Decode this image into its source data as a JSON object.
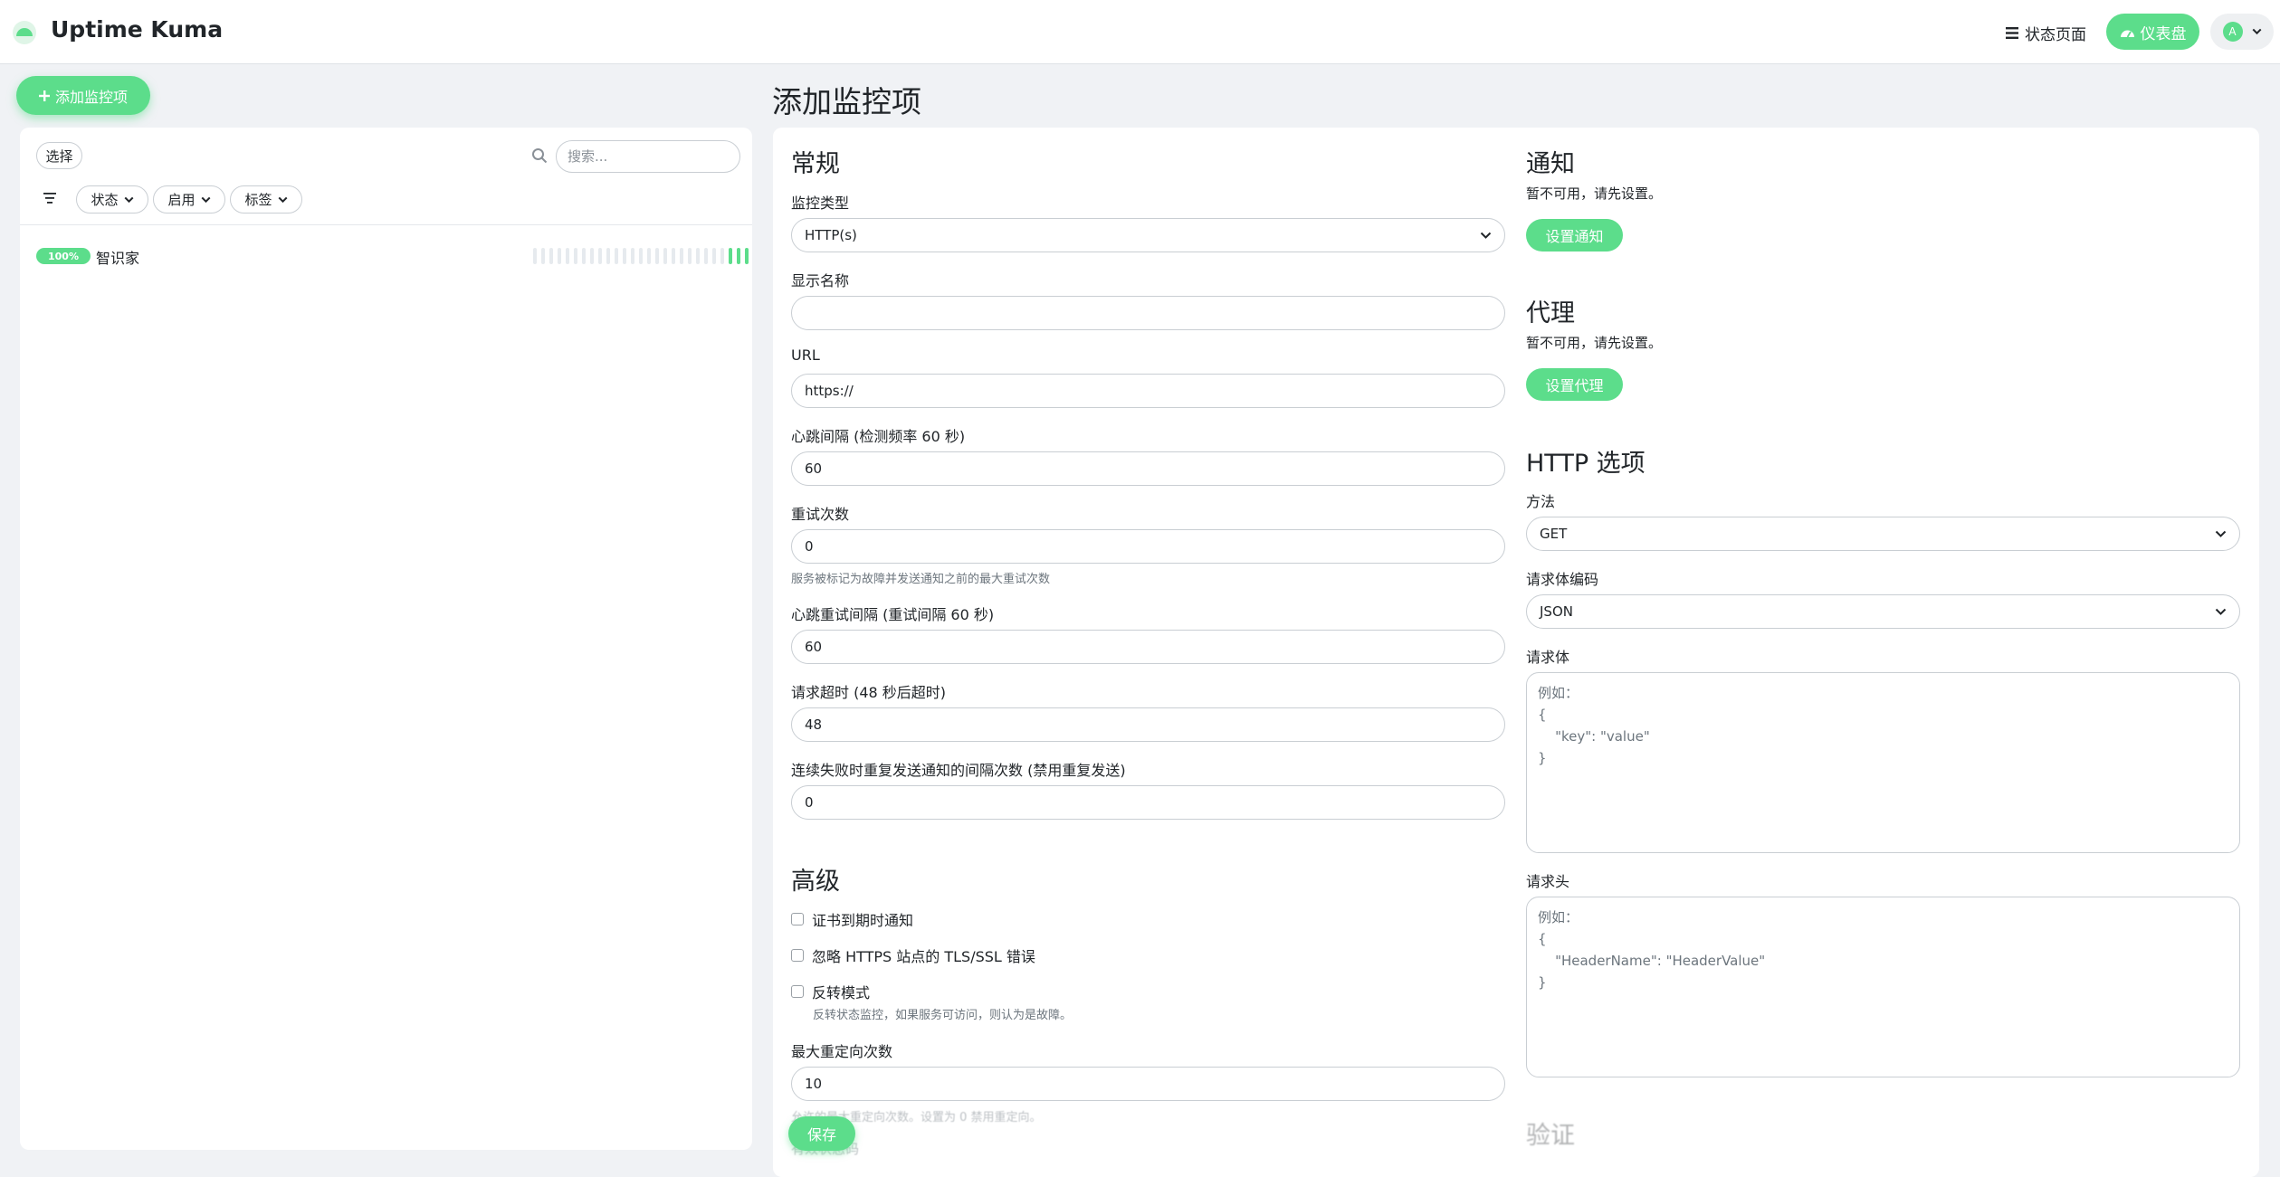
{
  "header": {
    "app_title": "Uptime Kuma",
    "status_page_label": "状态页面",
    "dashboard_label": "仪表盘",
    "avatar_letter": "A"
  },
  "sidebar": {
    "add_monitor_label": "添加监控项",
    "select_label": "选择",
    "search_placeholder": "搜索...",
    "filters": [
      "状态",
      "启用",
      "标签"
    ],
    "monitors": [
      {
        "uptime": "100%",
        "name": "智识家",
        "beats_up": 3,
        "beats_total": 27
      }
    ]
  },
  "page": {
    "title": "添加监控项"
  },
  "general": {
    "title": "常规",
    "monitor_type_label": "监控类型",
    "monitor_type_value": "HTTP(s)",
    "display_name_label": "显示名称",
    "display_name_value": "",
    "url_label": "URL",
    "url_value": "https://",
    "interval_label": "心跳间隔 (检测频率 60 秒)",
    "interval_value": "60",
    "retries_label": "重试次数",
    "retries_value": "0",
    "retries_hint": "服务被标记为故障并发送通知之前的最大重试次数",
    "retry_interval_label": "心跳重试间隔 (重试间隔 60 秒)",
    "retry_interval_value": "60",
    "timeout_label": "请求超时 (48 秒后超时)",
    "timeout_value": "48",
    "resend_label": "连续失败时重复发送通知的间隔次数 (禁用重复发送)",
    "resend_value": "0"
  },
  "advanced": {
    "title": "高级",
    "cert_expiry_label": "证书到期时通知",
    "ignore_tls_label": "忽略 HTTPS 站点的 TLS/SSL 错误",
    "upside_down_label": "反转模式",
    "upside_down_hint": "反转状态监控，如果服务可访问，则认为是故障。",
    "max_redirects_label": "最大重定向次数",
    "max_redirects_value": "10",
    "max_redirects_hint": "允许的最大重定向次数。设置为 0 禁用重定向。",
    "accepted_codes_label": "有效状态码"
  },
  "notifications": {
    "title": "通知",
    "empty_text": "暂不可用，请先设置。",
    "setup_button": "设置通知"
  },
  "proxy": {
    "title": "代理",
    "empty_text": "暂不可用，请先设置。",
    "setup_button": "设置代理"
  },
  "http_options": {
    "title": "HTTP 选项",
    "method_label": "方法",
    "method_value": "GET",
    "body_encoding_label": "请求体编码",
    "body_encoding_value": "JSON",
    "body_label": "请求体",
    "body_placeholder": "例如：\n{\n    \"key\": \"value\"\n}",
    "headers_label": "请求头",
    "headers_placeholder": "例如：\n{\n    \"HeaderName\": \"HeaderValue\"\n}"
  },
  "auth": {
    "title": "验证"
  },
  "footer": {
    "save_label": "保存"
  },
  "colors": {
    "accent": "#5cdd8b",
    "page_bg": "#f0f2f5"
  }
}
